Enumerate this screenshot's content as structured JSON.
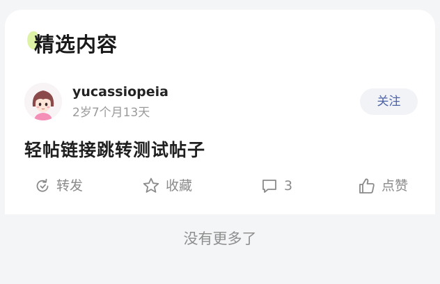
{
  "section": {
    "title": "精选内容"
  },
  "post": {
    "author": {
      "name": "yucassiopeia",
      "meta": "2岁7个月13天",
      "avatar_icon": "girl-avatar-icon"
    },
    "follow_label": "关注",
    "title": "轻帖链接跳转测试帖子",
    "actions": {
      "forward_label": "转发",
      "collect_label": "收藏",
      "comment_count": "3",
      "like_label": "点赞"
    }
  },
  "footer": {
    "text": "没有更多了"
  },
  "colors": {
    "page_background": "#f4f5f7",
    "card_background": "#ffffff",
    "accent_blob": "#dff3a6",
    "follow_text": "#4b62a8",
    "muted_text": "#8a8a8a"
  }
}
